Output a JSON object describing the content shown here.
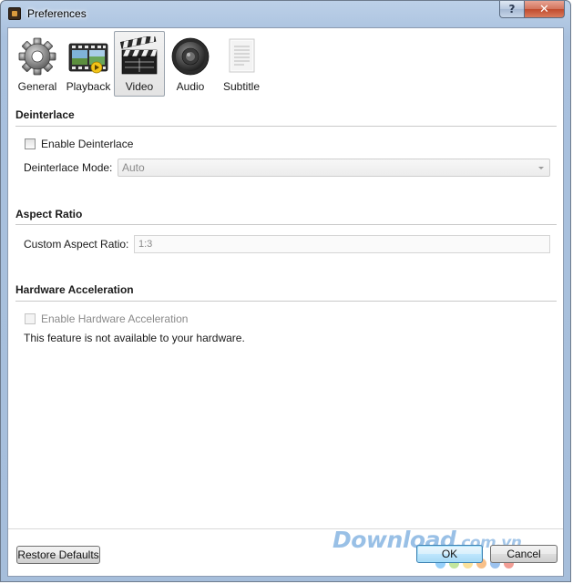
{
  "window": {
    "title": "Preferences",
    "help_glyph": "?",
    "close_glyph": "✕"
  },
  "toolbar": {
    "tabs": [
      {
        "label": "General",
        "icon": "gear-icon",
        "active": false
      },
      {
        "label": "Playback",
        "icon": "film-strip-icon",
        "active": false
      },
      {
        "label": "Video",
        "icon": "clapperboard-icon",
        "active": true
      },
      {
        "label": "Audio",
        "icon": "speaker-icon",
        "active": false
      },
      {
        "label": "Subtitle",
        "icon": "document-icon",
        "active": false
      }
    ]
  },
  "deinterlace": {
    "title": "Deinterlace",
    "enable_label": "Enable Deinterlace",
    "enable_checked": false,
    "mode_label": "Deinterlace Mode:",
    "mode_value": "Auto"
  },
  "aspect_ratio": {
    "title": "Aspect Ratio",
    "custom_label": "Custom Aspect Ratio:",
    "custom_placeholder": "1:3"
  },
  "hardware": {
    "title": "Hardware Acceleration",
    "enable_label": "Enable Hardware Acceleration",
    "enable_checked": false,
    "note": "This feature is not available to your hardware."
  },
  "footer": {
    "restore_label": "Restore Defaults",
    "ok_label": "OK",
    "cancel_label": "Cancel"
  },
  "watermark": {
    "main": "Download",
    "suffix": ".com.vn"
  },
  "colors": {
    "accent": "#3c7fb1",
    "dots": [
      "#3fa9f5",
      "#8fd14f",
      "#f7c948",
      "#f28c28",
      "#4a8fe0",
      "#e84c3d"
    ]
  }
}
